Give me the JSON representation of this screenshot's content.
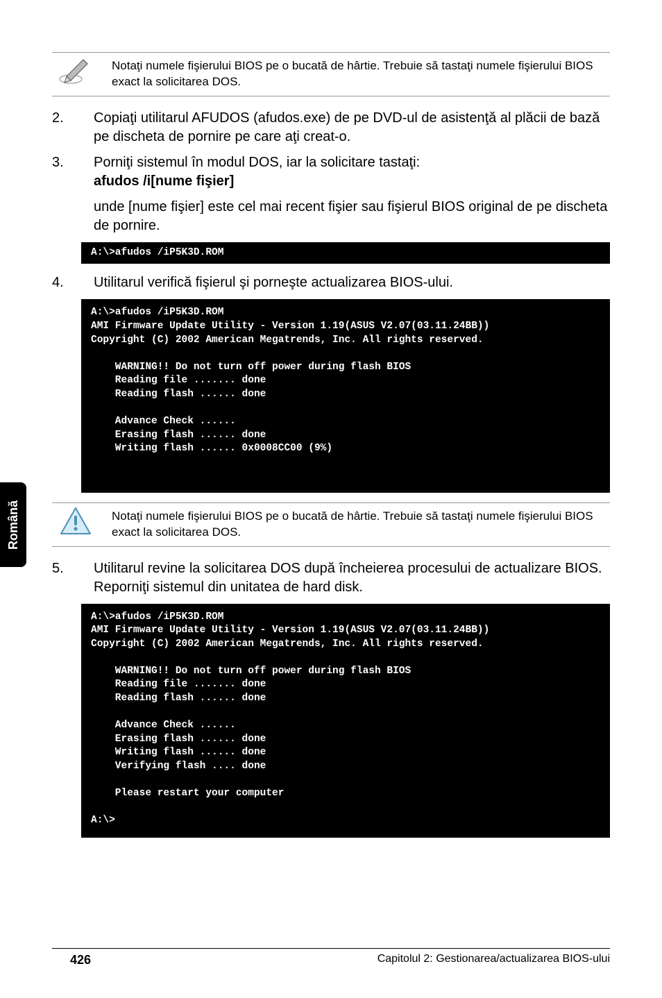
{
  "sidetab": "Română",
  "note1": "Notaţi numele fişierului BIOS pe o bucată de hârtie. Trebuie să tastaţi numele fişierului BIOS exact la solicitarea DOS.",
  "step2": {
    "num": "2.",
    "text": "Copiaţi utilitarul AFUDOS (afudos.exe) de pe DVD-ul de asistenţă al plăcii de bază pe discheta de pornire pe care aţi creat-o."
  },
  "step3": {
    "num": "3.",
    "line1": "Porniţi sistemul în modul DOS, iar la solicitare tastaţi:",
    "line2": "afudos /i[nume fişier]",
    "cont": "unde [nume fişier] este cel mai recent fişier sau fişierul BIOS original de pe discheta de pornire."
  },
  "term1": "A:\\>afudos /iP5K3D.ROM",
  "step4": {
    "num": "4.",
    "text": "Utilitarul verifică fişierul şi porneşte actualizarea BIOS-ului."
  },
  "term2": "A:\\>afudos /iP5K3D.ROM\nAMI Firmware Update Utility - Version 1.19(ASUS V2.07(03.11.24BB))\nCopyright (C) 2002 American Megatrends, Inc. All rights reserved.\n\n    WARNING!! Do not turn off power during flash BIOS\n    Reading file ....... done\n    Reading flash ...... done\n\n    Advance Check ......\n    Erasing flash ...... done\n    Writing flash ...... 0x0008CC00 (9%)\n\n\n",
  "note2": "Notaţi numele fişierului BIOS pe o bucată de hârtie. Trebuie să tastaţi numele fişierului BIOS exact la solicitarea DOS.",
  "step5": {
    "num": "5.",
    "text": "Utilitarul revine la solicitarea DOS după încheierea procesului de actualizare BIOS. Reporniţi sistemul din unitatea de hard disk."
  },
  "term3": "A:\\>afudos /iP5K3D.ROM\nAMI Firmware Update Utility - Version 1.19(ASUS V2.07(03.11.24BB))\nCopyright (C) 2002 American Megatrends, Inc. All rights reserved.\n\n    WARNING!! Do not turn off power during flash BIOS\n    Reading file ....... done\n    Reading flash ...... done\n\n    Advance Check ......\n    Erasing flash ...... done\n    Writing flash ...... done\n    Verifying flash .... done\n\n    Please restart your computer\n\nA:\\>",
  "footer": {
    "page": "426",
    "chapter": "Capitolul 2: Gestionarea/actualizarea BIOS-ului"
  }
}
